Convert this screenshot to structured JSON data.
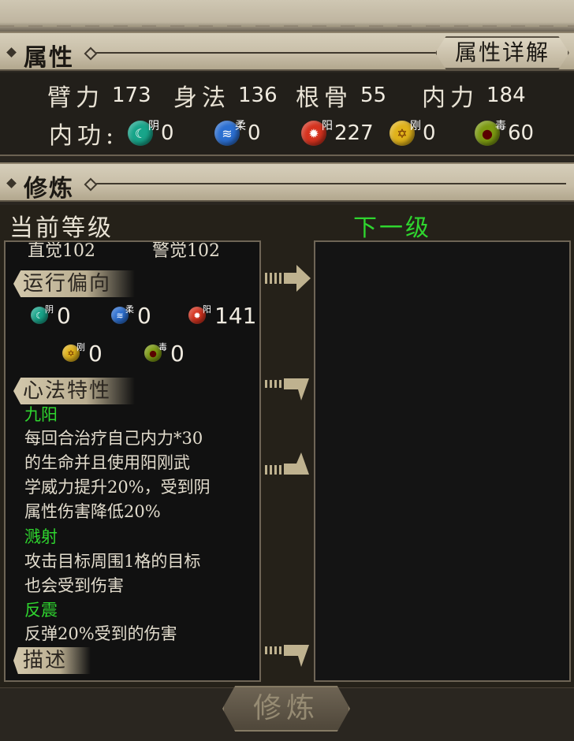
{
  "attributes": {
    "title": "属性",
    "detail_button": "属性详解",
    "stats": [
      {
        "label": "臂力",
        "value": "173"
      },
      {
        "label": "身法",
        "value": "136"
      },
      {
        "label": "根骨",
        "value": "55"
      },
      {
        "label": "内力",
        "value": "184"
      }
    ],
    "neigong_label": "内功:",
    "elements": [
      {
        "name": "阴",
        "value": "0",
        "icon": "yin-orb-icon",
        "color": "#18a58a"
      },
      {
        "name": "柔",
        "value": "0",
        "icon": "rou-orb-icon",
        "color": "#2c6fd1"
      },
      {
        "name": "阳",
        "value": "227",
        "icon": "yang-orb-icon",
        "color": "#d6331f"
      },
      {
        "name": "刚",
        "value": "0",
        "icon": "gang-orb-icon",
        "color": "#e0b21a"
      },
      {
        "name": "毒",
        "value": "60",
        "icon": "du-orb-icon",
        "color": "#7c9a12"
      }
    ]
  },
  "cultivation": {
    "title": "修炼",
    "current_level_label": "当前等级",
    "next_level_label": "下一级",
    "partial_row": {
      "left": "直觉102",
      "right": "警觉102"
    },
    "bias_tag": "运行偏向",
    "bias_elements": [
      {
        "name": "阴",
        "value": "0",
        "color": "#18a58a"
      },
      {
        "name": "柔",
        "value": "0",
        "color": "#2c6fd1"
      },
      {
        "name": "阳",
        "value": "141",
        "color": "#d6331f"
      },
      {
        "name": "刚",
        "value": "0",
        "color": "#e0b21a"
      },
      {
        "name": "毒",
        "value": "0",
        "color": "#7c9a12"
      }
    ],
    "traits_tag": "心法特性",
    "traits": [
      {
        "name": "九阳",
        "lines": [
          "每回合治疗自己内力*30",
          "的生命并且使用阳刚武",
          "学威力提升20%，受到阴",
          "属性伤害降低20%"
        ]
      },
      {
        "name": "溅射",
        "lines": [
          "攻击目标周围1格的目标",
          "也会受到伤害"
        ]
      },
      {
        "name": "反震",
        "lines": [
          "反弹20%受到的伤害"
        ]
      }
    ],
    "desc_tag": "描述",
    "cultivate_button": "修炼"
  },
  "colors": {
    "green": "#2fd52f",
    "panel_bg": "#111111"
  }
}
